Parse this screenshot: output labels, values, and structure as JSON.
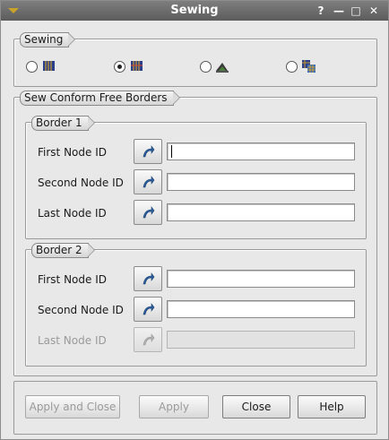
{
  "window": {
    "title": "Sewing",
    "help_glyph": "?",
    "minimize_glyph": "—",
    "maximize_glyph": "□",
    "close_glyph": "✕"
  },
  "sewing_group": {
    "label": "Sewing",
    "modes": [
      {
        "icon": "free-borders-icon",
        "checked": false
      },
      {
        "icon": "conform-free-borders-icon",
        "checked": true
      },
      {
        "icon": "border-to-side-icon",
        "checked": false
      },
      {
        "icon": "side-elements-icon",
        "checked": false
      }
    ]
  },
  "conform_group": {
    "label": "Sew Conform Free Borders",
    "border1": {
      "label": "Border 1",
      "rows": [
        {
          "label": "First Node ID",
          "value": "",
          "enabled": true,
          "focused": true
        },
        {
          "label": "Second Node ID",
          "value": "",
          "enabled": true
        },
        {
          "label": "Last Node ID",
          "value": "",
          "enabled": true
        }
      ]
    },
    "border2": {
      "label": "Border 2",
      "rows": [
        {
          "label": "First Node ID",
          "value": "",
          "enabled": true
        },
        {
          "label": "Second Node ID",
          "value": "",
          "enabled": true
        },
        {
          "label": "Last Node ID",
          "value": "",
          "enabled": false
        }
      ]
    }
  },
  "buttons": {
    "apply_close": "Apply and Close",
    "apply": "Apply",
    "close": "Close",
    "help": "Help"
  },
  "colors": {
    "titlebar": "#6b6b6b",
    "selector_icon": "#2c5f9e",
    "window_bg": "#e8e8e8"
  }
}
